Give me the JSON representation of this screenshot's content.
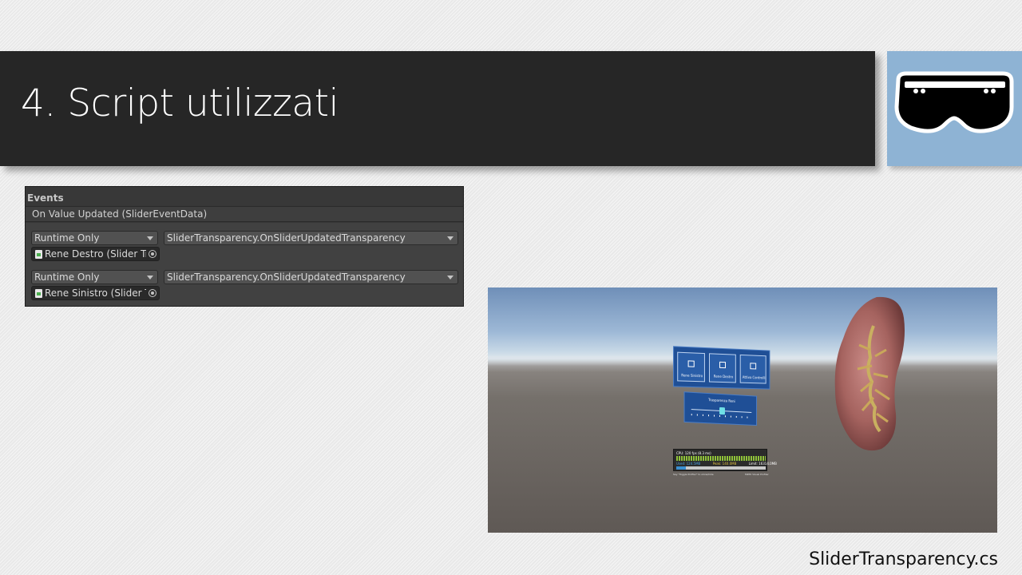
{
  "slide": {
    "title": "4. Script utilizzati",
    "footer": "SliderTransparency.cs",
    "logo_icon": "mixed-reality-headset-icon",
    "colors": {
      "title_bar": "#262626",
      "logo_background": "#8eb3d4",
      "page_background": "#e9e9e9"
    }
  },
  "inspector": {
    "section_label": "Events",
    "event_name": "On Value Updated (SliderEventData)",
    "listeners": [
      {
        "runtime_mode": "Runtime Only",
        "function": "SliderTransparency.OnSliderUpdatedTransparency",
        "target_object": "Rene Destro (Slider Tr"
      },
      {
        "runtime_mode": "Runtime Only",
        "function": "SliderTransparency.OnSliderUpdatedTransparency",
        "target_object": "Rene Sinistro (Slider T"
      }
    ]
  },
  "scene_preview": {
    "menu_buttons": [
      "Rene Sinistro",
      "Rene Destro",
      "Attiva Controlli"
    ],
    "slider_title": "Trasparenza Reni",
    "slider_value": 0.5,
    "profiler": {
      "cpu_text": "CPU: 120 fps (8.3 ms)",
      "used_text": "Used: 124.5MB",
      "peak_text": "Peak: 140.0MB",
      "limit_text": "Limit: 16314.0MB"
    },
    "hint_left": "Say \"Toggle Profiler\" to show/hide",
    "hint_right": "MRTK Visual Profiler"
  }
}
